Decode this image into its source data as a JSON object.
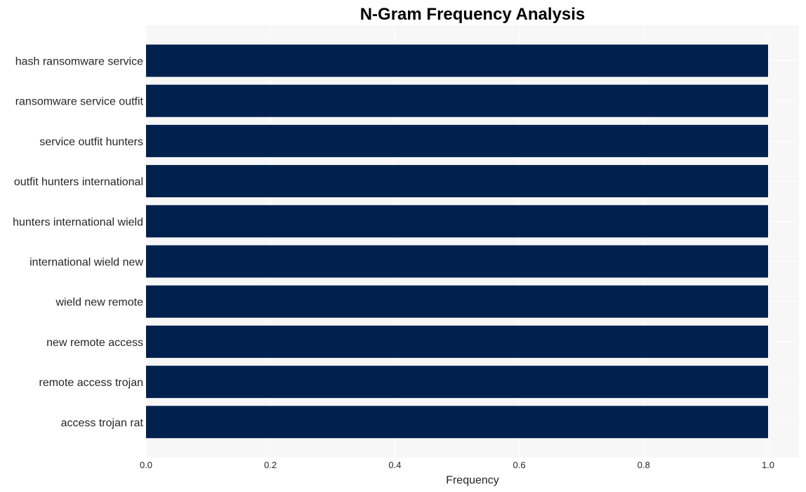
{
  "chart_data": {
    "type": "bar",
    "orientation": "horizontal",
    "title": "N-Gram Frequency Analysis",
    "xlabel": "Frequency",
    "ylabel": "",
    "categories": [
      "hash ransomware service",
      "ransomware service outfit",
      "service outfit hunters",
      "outfit hunters international",
      "hunters international wield",
      "international wield new",
      "wield new remote",
      "new remote access",
      "remote access trojan",
      "access trojan rat"
    ],
    "values": [
      1,
      1,
      1,
      1,
      1,
      1,
      1,
      1,
      1,
      1
    ],
    "xlim": [
      0,
      1.05
    ],
    "xticks": [
      "0.0",
      "0.2",
      "0.4",
      "0.6",
      "0.8",
      "1.0"
    ],
    "xtick_values": [
      0,
      0.2,
      0.4,
      0.6,
      0.8,
      1.0
    ],
    "grid": true,
    "legend": "none",
    "colors": {
      "bar": "#00214e",
      "plot_background": "#f7f7f7",
      "grid": "#ffffff"
    }
  }
}
